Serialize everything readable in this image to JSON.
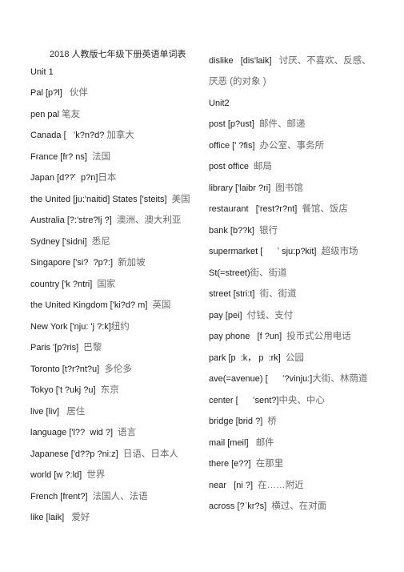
{
  "title": "2018 人教版七年级下册英语单词表",
  "left_column": [
    {
      "en": "Unit 1",
      "zh": ""
    },
    {
      "en": "Pal [p?l]   ",
      "zh": "伙伴"
    },
    {
      "en": "pen pal ",
      "zh": "笔友"
    },
    {
      "en": "Canada [   ʻk?n?d? ",
      "zh": "加拿大"
    },
    {
      "en": "France [fr? ns]  ",
      "zh": "法国"
    },
    {
      "en": "Japan [d??ʼ  p?n]",
      "zh": "日本"
    },
    {
      "en": "the United [ju:'naitid] States ['steits]  ",
      "zh": "美国"
    },
    {
      "en": "Australia [?:'stre?lj ?]  ",
      "zh": "澳洲、澳大利亚"
    },
    {
      "en": "Sydney ['sidni]  ",
      "zh": "悉尼"
    },
    {
      "en": "Singapore ['si?  ?p?:]  ",
      "zh": "新加坡"
    },
    {
      "en": "country ['k ?ntri]  ",
      "zh": "国家"
    },
    {
      "en": "the United Kingdom ['ki?d? m]  ",
      "zh": "英国"
    },
    {
      "en": "New York ['nju: 'j ?:k]",
      "zh": "纽约"
    },
    {
      "en": "Paris '[p?ris]  ",
      "zh": "巴黎"
    },
    {
      "en": "Toronto [t?r?nt?u]  ",
      "zh": "多伦多"
    },
    {
      "en": "Tokyo ['t ?ukj ?u]  ",
      "zh": "东京"
    },
    {
      "en": "live [liv]   ",
      "zh": "居住"
    },
    {
      "en": "language ['l??  wid ?]  ",
      "zh": "语言"
    },
    {
      "en": "Japanese ['d??p ?ni:z]  ",
      "zh": "日语、日本人"
    },
    {
      "en": "world [w ?:ld]  ",
      "zh": "世界"
    },
    {
      "en": "French [frent?]  ",
      "zh": "法国人、法语"
    },
    {
      "en": "like [laik]   ",
      "zh": "爱好"
    }
  ],
  "right_column": [
    {
      "en": "dislike   [dis'laik]   ",
      "zh": "讨厌、不喜欢、反感、"
    },
    {
      "en": "",
      "zh": "厌恶 (的对象 )"
    },
    {
      "en": "Unit2",
      "zh": ""
    },
    {
      "en": "post [p?ust]  ",
      "zh": "邮件、邮递"
    },
    {
      "en": "office [' ?fis]  ",
      "zh": "办公室、事务所"
    },
    {
      "en": "post office  ",
      "zh": "邮局"
    },
    {
      "en": "library ['laibr ?ri]  ",
      "zh": "图书馆"
    },
    {
      "en": "restaurant   ['rest?r?nt]  ",
      "zh": "餐馆、饭店"
    },
    {
      "en": "bank [b??k]  ",
      "zh": "银行"
    },
    {
      "en": "supermarket [      ʼ sju:p?kit]  ",
      "zh": "超级市场"
    },
    {
      "en": "St(=street)",
      "zh": "街、街道"
    },
    {
      "en": "street [stri:t]  ",
      "zh": "街、街道"
    },
    {
      "en": "pay [pei]  ",
      "zh": "付钱、支付"
    },
    {
      "en": "pay phone   [f ?un]  ",
      "zh": "投币式公用电话"
    },
    {
      "en": "park [p  :k， p  :rk]  ",
      "zh": "公园"
    },
    {
      "en": "ave(=avenue) [      ʻ?vinju:]",
      "zh": "大街、林荫道"
    },
    {
      "en": "center [      ʻsent?]",
      "zh": "中央、中心"
    },
    {
      "en": "bridge [brid ?]  ",
      "zh": "桥"
    },
    {
      "en": "mail [meil]   ",
      "zh": "邮件"
    },
    {
      "en": "there [e??]  ",
      "zh": "在那里"
    },
    {
      "en": "near   [ni ?]  ",
      "zh": "在……附近"
    },
    {
      "en": "across [?ˈkr?s]  ",
      "zh": "横过、在对面"
    }
  ]
}
